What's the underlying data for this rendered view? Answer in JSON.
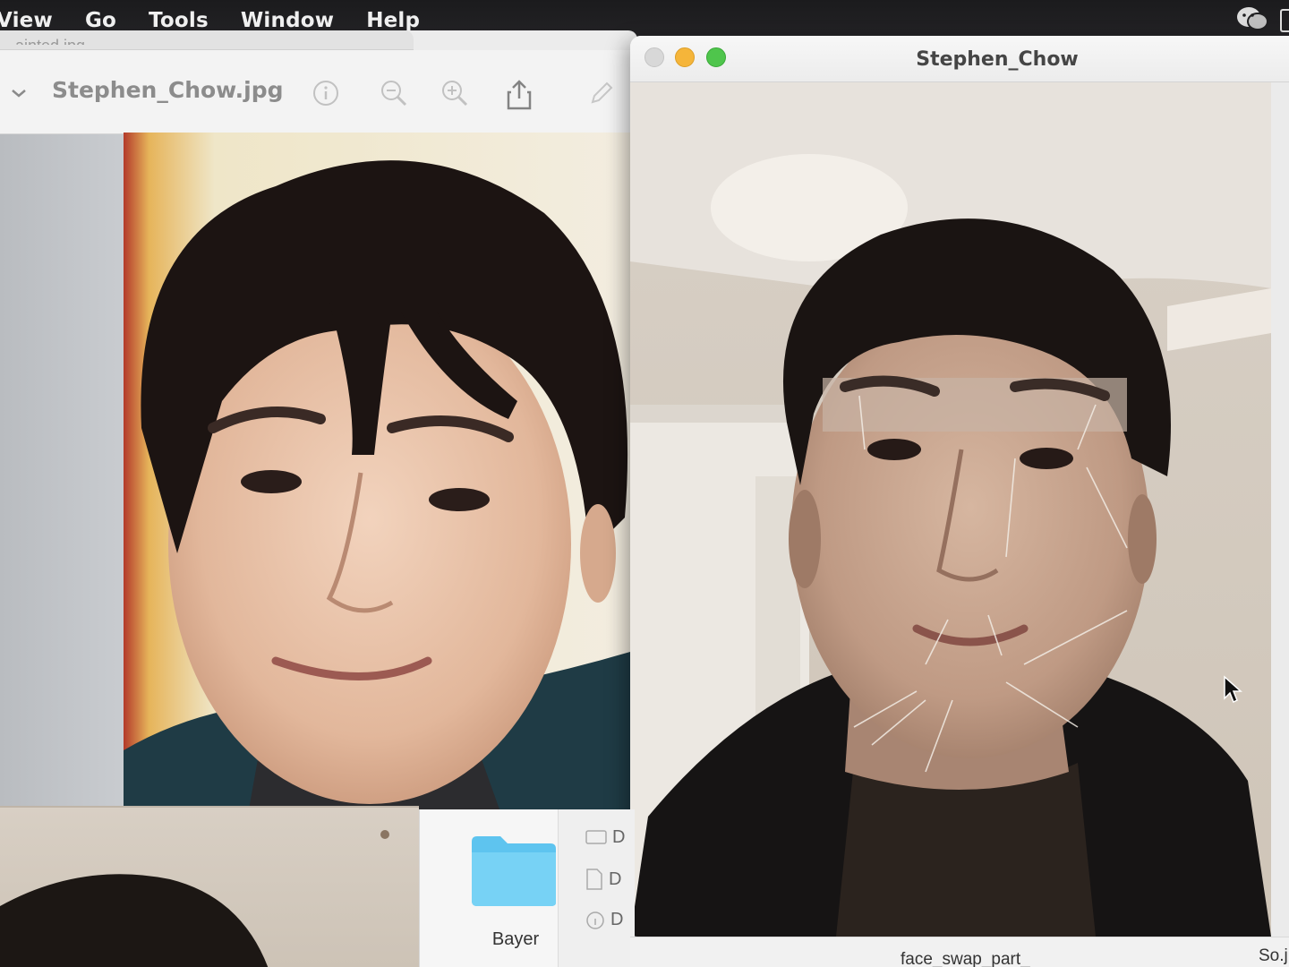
{
  "menubar": {
    "items": [
      "View",
      "Go",
      "Tools",
      "Window",
      "Help"
    ],
    "wechat_icon": "wechat-icon"
  },
  "preview_window": {
    "tab_title": "...ainted.jpg",
    "title": "Stephen_Chow.jpg",
    "toolbar_icons": [
      "chevron-down-icon",
      "info-icon",
      "zoom-out-icon",
      "zoom-in-icon",
      "share-icon",
      "markup-icon"
    ]
  },
  "camera_window": {
    "title": "Stephen_Chow",
    "traffic_lights": [
      "close",
      "minimize",
      "maximize"
    ]
  },
  "finder": {
    "folder_label": "Bayer",
    "list_items": [
      "D",
      "D",
      "D"
    ]
  },
  "bottom_strip": {
    "file_label": "face_swap_part_",
    "file_label_2": "So.j"
  },
  "colors": {
    "menubar": "#1b1b1d",
    "traffic_close": "#d8d8d8",
    "traffic_min": "#f5b53a",
    "traffic_max": "#4fc54c",
    "folder_blue": "#5ec4ef"
  }
}
